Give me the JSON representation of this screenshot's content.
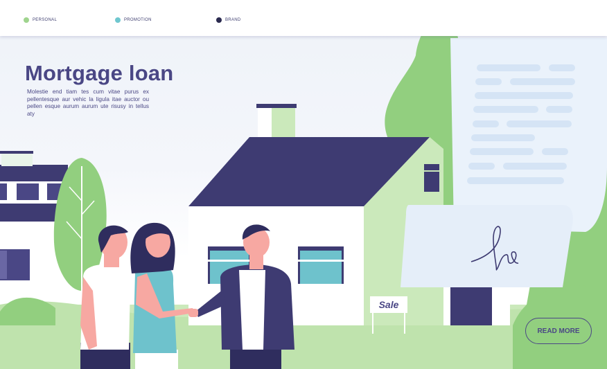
{
  "nav": {
    "items": [
      {
        "label": "PERSONAL",
        "color": "#9fd48e"
      },
      {
        "label": "PROMOTION",
        "color": "#6fc7cf"
      },
      {
        "label": "BRAND",
        "color": "#2b2a4f"
      }
    ]
  },
  "hero": {
    "title": "Mortgage loan",
    "description": "Molestie end tiam tes cum vitae purus ex pellentesque aur vehic la ligula itae auctor ou pellen esque aurum aurum ute risusy in tellus aty"
  },
  "sign": {
    "label": "Sale"
  },
  "cta": {
    "read_more_label": "READ MORE"
  },
  "colors": {
    "navy": "#4a4785",
    "dark_navy": "#2f2d5e",
    "light_green": "#cbe9bb",
    "green": "#92cf7f",
    "teal": "#6ec2cc",
    "paper": "#eaf2fb"
  }
}
